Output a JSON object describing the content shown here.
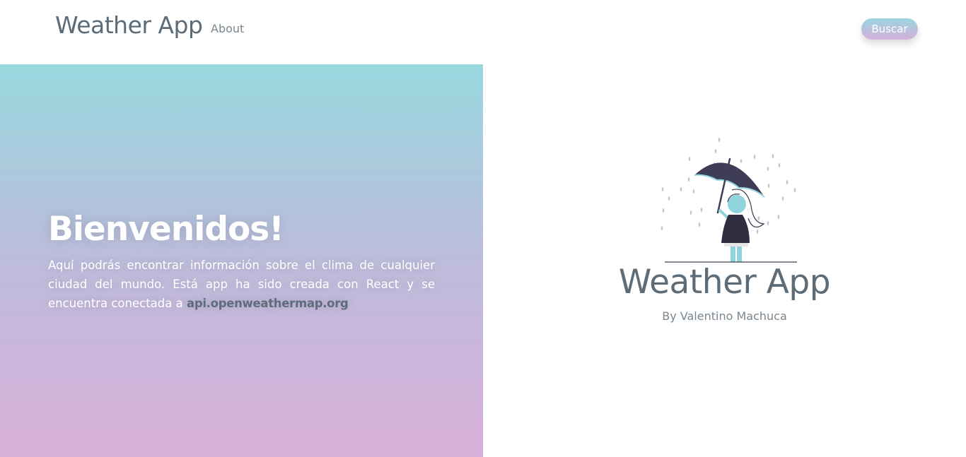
{
  "nav": {
    "brand": "Weather App",
    "about_link": "About",
    "search_button": "Buscar"
  },
  "hero": {
    "title": "Bienvenidos!",
    "description": "Aquí podrás encontrar información sobre el clima de cualquier ciudad del mundo. Está app ha sido creada con React y se encuentra conectada a",
    "api_link": "api.openweathermap.org"
  },
  "brand_card": {
    "title": "Weather App",
    "author": "By Valentino Machuca",
    "illustration_icon": "girl-with-umbrella-in-rain-illustration"
  },
  "colors": {
    "gradient_top": "#98d8df",
    "gradient_bottom": "#d8afd9",
    "text_dark": "#5e6c78",
    "umbrella": "#3f3d56",
    "accent": "#8fd3dd"
  }
}
